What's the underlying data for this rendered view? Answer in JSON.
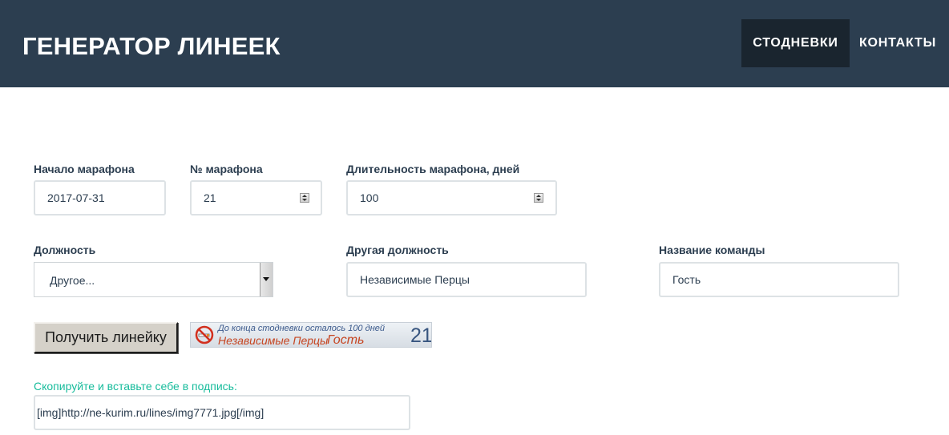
{
  "header": {
    "brand": "ГЕНЕРАТОР ЛИНЕЕК",
    "nav": [
      {
        "label": "СТОДНЕВКИ",
        "active": true
      },
      {
        "label": "КОНТАКТЫ",
        "active": false
      }
    ]
  },
  "form": {
    "start": {
      "label": "Начало марафона",
      "value": "2017-07-31"
    },
    "number": {
      "label": "№ марафона",
      "value": "21"
    },
    "duration": {
      "label": "Длительность марафона, дней",
      "value": "100"
    },
    "position": {
      "label": "Должность",
      "value": "Другое..."
    },
    "other_position": {
      "label": "Другая должность",
      "value": "Независимые Перцы"
    },
    "team": {
      "label": "Название команды",
      "value": "Гость"
    },
    "submit_label": "Получить линейку"
  },
  "banner": {
    "line1": "До конца стодневки осталось 100 дней",
    "position": "Независимые Перцы",
    "team": "Гость",
    "number": "21"
  },
  "result": {
    "hint": "Скопируйте и вставьте себе в подпись:",
    "code": "[img]http://ne-kurim.ru/lines/img7771.jpg[/img]"
  },
  "colors": {
    "header_bg": "#2c3e50",
    "active_nav_bg": "#1a252f",
    "hint": "#18bc9c",
    "field_border": "#dde2e5"
  }
}
